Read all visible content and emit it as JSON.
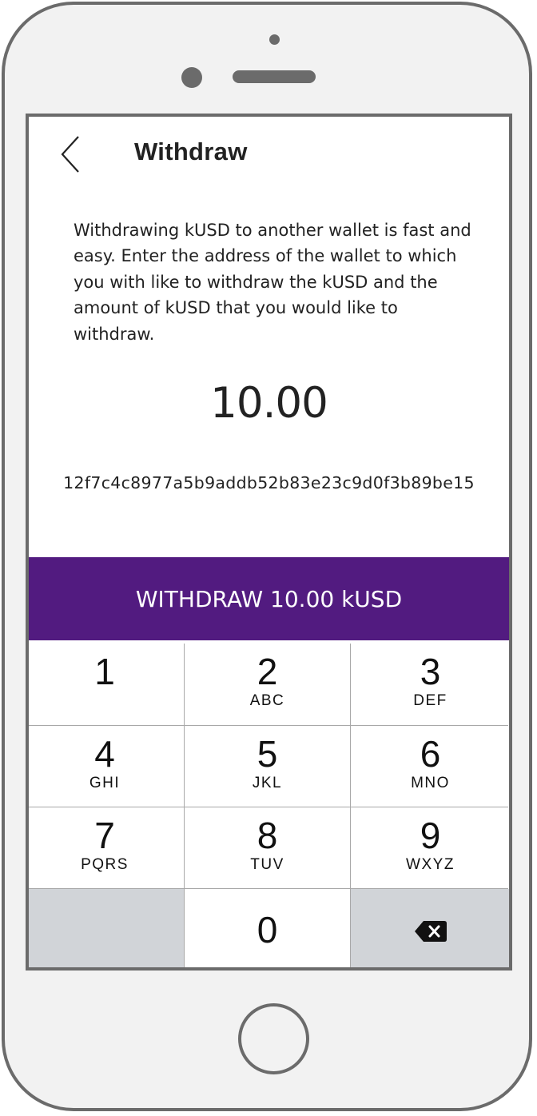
{
  "header": {
    "title": "Withdraw",
    "back_icon": "chevron-left-icon"
  },
  "content": {
    "description": "Withdrawing kUSD to another wallet is fast and easy. Enter the address of the wallet to which you with like to withdraw the kUSD and the amount of kUSD that you would like to withdraw.",
    "amount": "10.00",
    "address": "12f7c4c8977a5b9addb52b83e23c9d0f3b89be15"
  },
  "action": {
    "withdraw_label": "WITHDRAW 10.00 kUSD",
    "color": "#521b80"
  },
  "keypad": {
    "keys": [
      {
        "digit": "1",
        "letters": ""
      },
      {
        "digit": "2",
        "letters": "ABC"
      },
      {
        "digit": "3",
        "letters": "DEF"
      },
      {
        "digit": "4",
        "letters": "GHI"
      },
      {
        "digit": "5",
        "letters": "JKL"
      },
      {
        "digit": "6",
        "letters": "MNO"
      },
      {
        "digit": "7",
        "letters": "PQRS"
      },
      {
        "digit": "8",
        "letters": "TUV"
      },
      {
        "digit": "9",
        "letters": "WXYZ"
      },
      {
        "digit": "0",
        "letters": ""
      }
    ],
    "backspace_icon": "backspace-icon"
  }
}
